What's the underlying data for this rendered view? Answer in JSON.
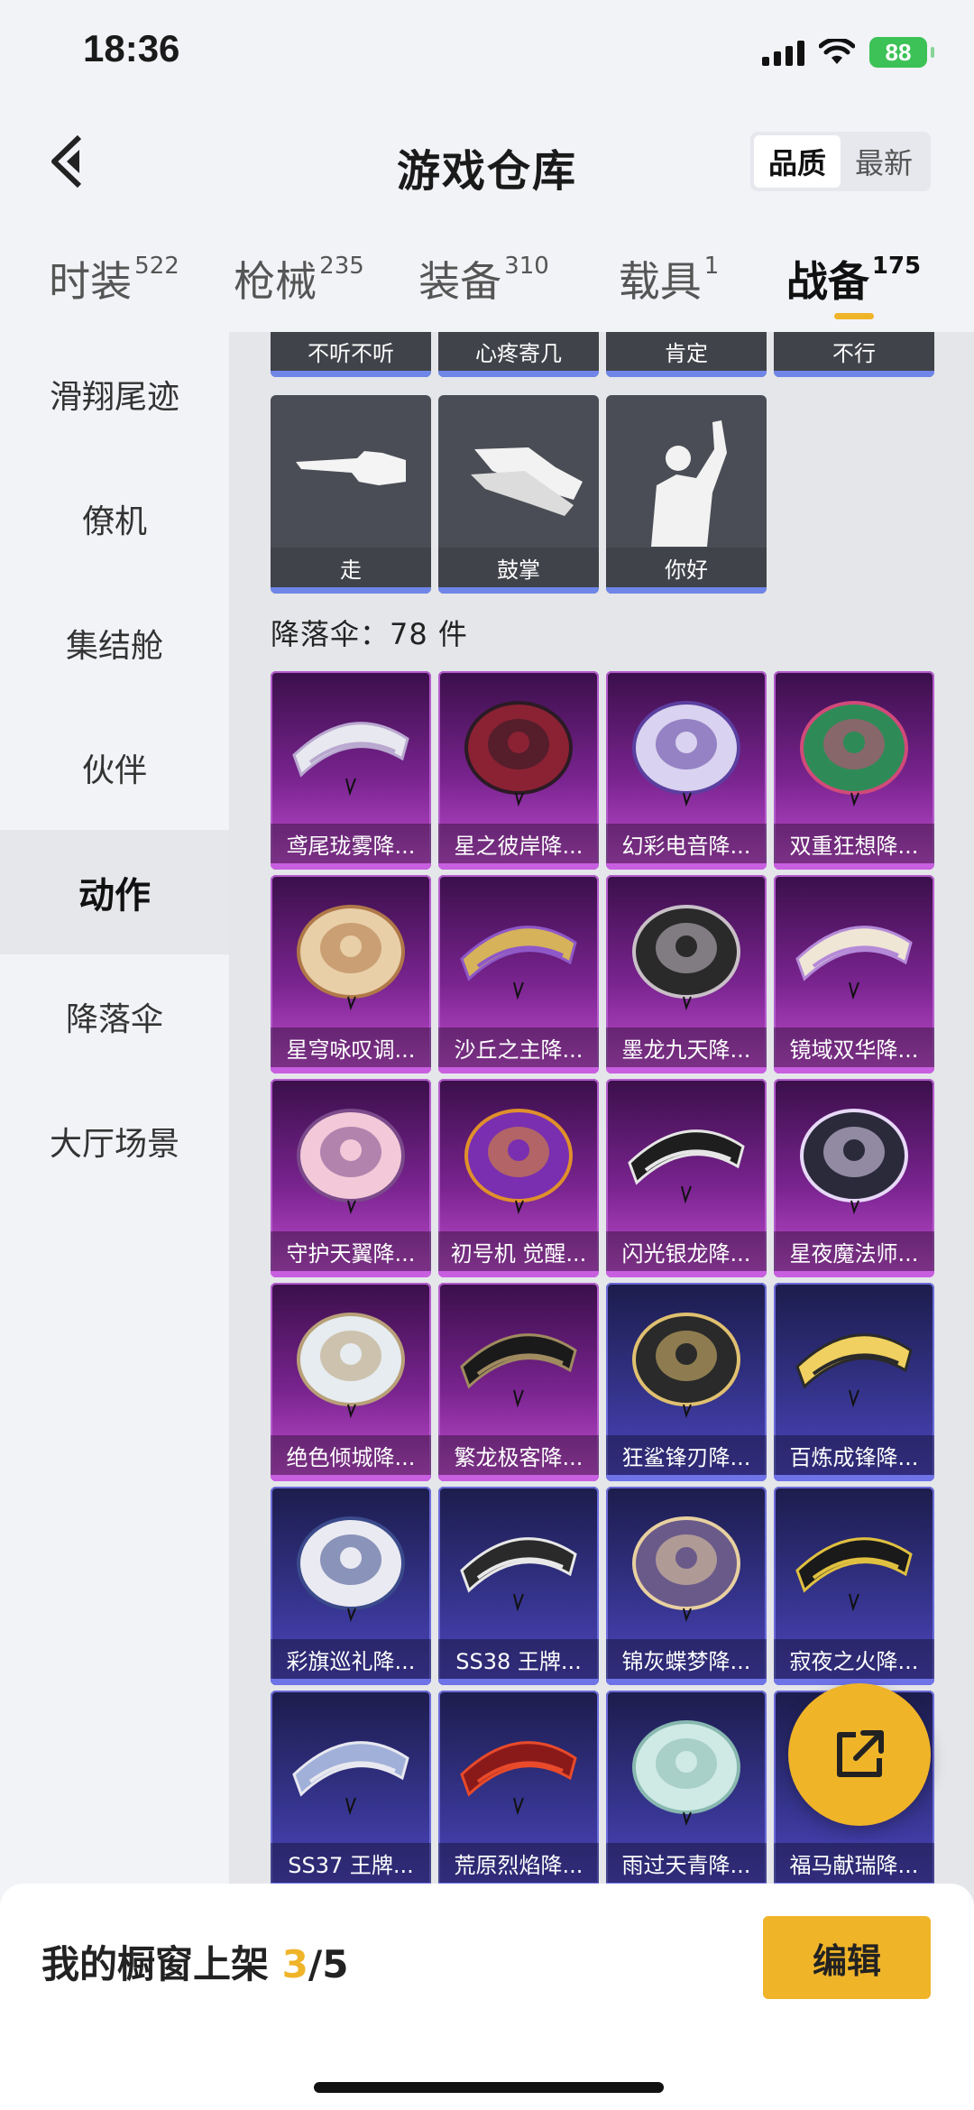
{
  "status": {
    "time": "18:36",
    "battery": "88"
  },
  "header": {
    "title": "游戏仓库",
    "sort": [
      "品质",
      "最新"
    ]
  },
  "tabs": [
    {
      "label": "时装",
      "count": "522"
    },
    {
      "label": "枪械",
      "count": "235"
    },
    {
      "label": "装备",
      "count": "310"
    },
    {
      "label": "载具",
      "count": "1"
    },
    {
      "label": "战备",
      "count": "175"
    }
  ],
  "sidebar": [
    "滑翔尾迹",
    "僚机",
    "集结舱",
    "伙伴",
    "动作",
    "降落伞",
    "大厅场景"
  ],
  "emotes_top": [
    "不听不听",
    "心疼寄几",
    "肯定",
    "不行"
  ],
  "emotes": [
    "走",
    "鼓掌",
    "你好"
  ],
  "section": "降落伞：78 件",
  "parachutes": [
    "鸢尾珑雾降...",
    "星之彼岸降...",
    "幻彩电音降...",
    "双重狂想降...",
    "星穹咏叹调...",
    "沙丘之主降...",
    "墨龙九天降...",
    "镜域双华降...",
    "守护天翼降...",
    "初号机 觉醒...",
    "闪光银龙降...",
    "星夜魔法师...",
    "绝色倾城降...",
    "繁龙极客降...",
    "狂鲨锋刃降...",
    "百炼成锋降...",
    "彩旗巡礼降...",
    "SS38 王牌...",
    "锦灰蝶梦降...",
    "寂夜之火降...",
    "SS37 王牌...",
    "荒原烈焰降...",
    "雨过天青降...",
    "福马献瑞降..."
  ],
  "colors": {
    "accent": "#f0b429",
    "purple_tier": "#7a2490",
    "blue_tier": "#34338a"
  },
  "bottom": {
    "shelf_label": "我的橱窗上架 ",
    "shelf_count": "3",
    "shelf_total": "/5",
    "edit": "编辑"
  }
}
